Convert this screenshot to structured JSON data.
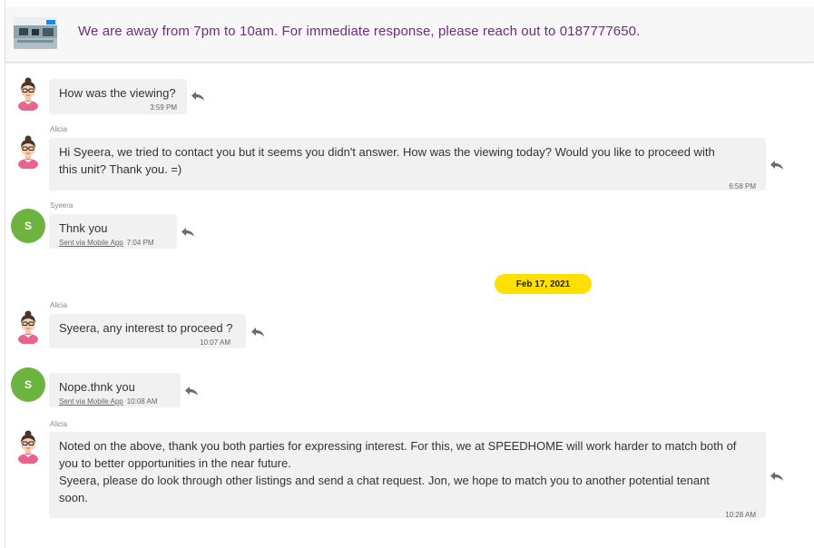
{
  "banner": {
    "thumbnail_icon": "office-photo",
    "message": "We are away from 7pm to 10am. For immediate response, please reach out to 0187777650."
  },
  "messages": [
    {
      "sender": "",
      "text": "How was the viewing?",
      "via": "",
      "time": "3:59 PM"
    },
    {
      "sender": "Alicia",
      "text": "Hi Syeera, we tried to contact you but it seems you didn't answer. How was the viewing today? Would you like to proceed with\nthis unit? Thank you. =)",
      "via": "",
      "time": "6:58 PM"
    },
    {
      "sender": "Syeera",
      "avatar_letter": "S",
      "text": "Thnk you",
      "via": "Sent via Mobile App",
      "time": "7:04 PM"
    },
    {
      "sender": "Alicia",
      "text": "Syeera, any interest to proceed ?",
      "via": "",
      "time": "10:07 AM"
    },
    {
      "sender": "",
      "avatar_letter": "S",
      "text": "Nope.thnk you",
      "via": "Sent via Mobile App",
      "time": "10:08 AM"
    },
    {
      "sender": "Alicia",
      "text": "Noted on the above, thank you both parties for expressing interest. For this, we at SPEEDHOME will work harder to match both of\nyou to better opportunities in the near future.\nSyeera, please do look through other listings and send a chat request. Jon, we hope to match you to another potential tenant\nsoon.",
      "via": "",
      "time": "10:28 AM"
    }
  ],
  "date_divider": "Feb 17, 2021",
  "colors": {
    "banner_text": "#6b2f7a",
    "date_pill": "#ffe000",
    "user_avatar": "#6db33f",
    "bubble": "#f1f1f2"
  },
  "icons": {
    "reply": "reply-arrow-icon",
    "agent_avatar": "agent-avatar-icon"
  }
}
